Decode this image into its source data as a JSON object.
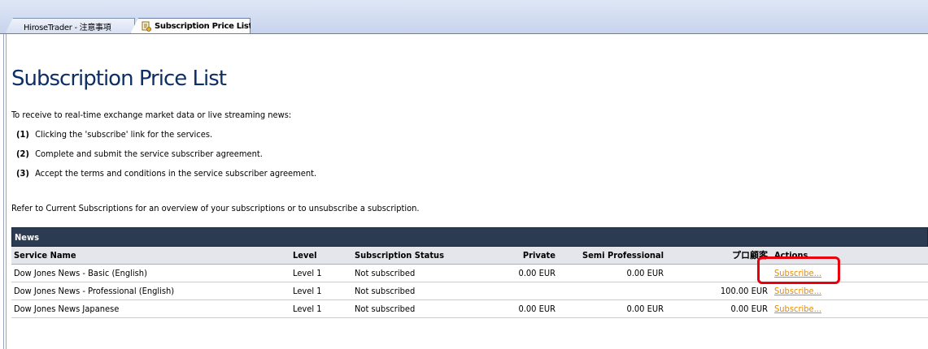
{
  "tabs": [
    {
      "label": "HiroseTrader - 注意事項",
      "active": false
    },
    {
      "label": "Subscription Price List",
      "active": true,
      "icon": "subscription-icon"
    }
  ],
  "page": {
    "title": "Subscription Price List",
    "intro": "To receive to real-time exchange market data or live streaming news:",
    "steps": [
      {
        "num": "(1)",
        "text": "Clicking the 'subscribe' link for the services."
      },
      {
        "num": "(2)",
        "text": "Complete and submit the service subscriber agreement."
      },
      {
        "num": "(3)",
        "text": "Accept the terms and conditions in the service subscriber agreement."
      }
    ],
    "refer": "Refer to Current Subscriptions for an overview of your subscriptions or to unsubscribe a subscription."
  },
  "table": {
    "section": "News",
    "columns": {
      "name": "Service Name",
      "level": "Level",
      "status": "Subscription Status",
      "private": "Private",
      "semi": "Semi Professional",
      "pro": "プロ顧客",
      "actions": "Actions"
    },
    "rows": [
      {
        "name": "Dow Jones News - Basic (English)",
        "level": "Level 1",
        "status": "Not subscribed",
        "private": "0.00 EUR",
        "semi": "0.00 EUR",
        "pro": "",
        "action": "Subscribe..."
      },
      {
        "name": "Dow Jones News - Professional (English)",
        "level": "Level 1",
        "status": "Not subscribed",
        "private": "",
        "semi": "",
        "pro": "100.00 EUR",
        "action": "Subscribe..."
      },
      {
        "name": "Dow Jones News Japanese",
        "level": "Level 1",
        "status": "Not subscribed",
        "private": "0.00 EUR",
        "semi": "0.00 EUR",
        "pro": "0.00 EUR",
        "action": "Subscribe..."
      }
    ]
  },
  "colors": {
    "title": "#0e2f66",
    "section_header_bg": "#2b3b52",
    "link": "#e58a00",
    "highlight": "#e8000d"
  }
}
